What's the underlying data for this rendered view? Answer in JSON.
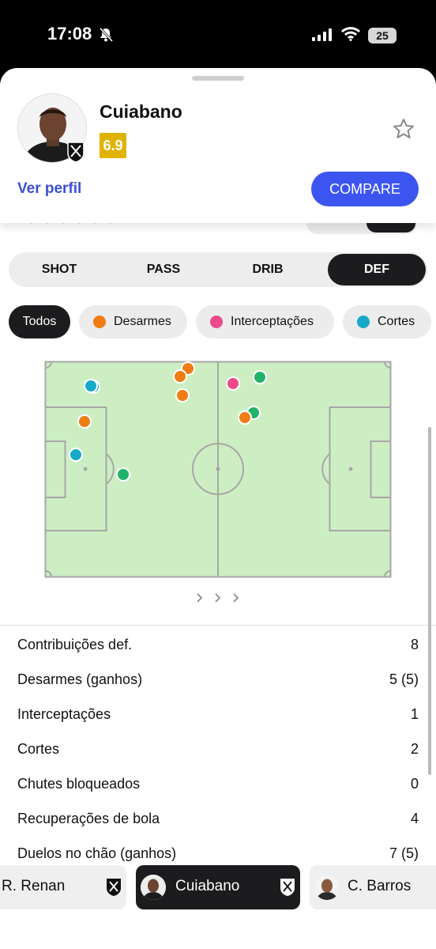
{
  "status_bar": {
    "time": "17:08",
    "battery": "25"
  },
  "player": {
    "name": "Cuiabano",
    "rating": "6.9"
  },
  "header": {
    "view_profile": "Ver perfil",
    "compare": "COMPARE"
  },
  "tabs": [
    {
      "label": "SHOT",
      "active": false
    },
    {
      "label": "PASS",
      "active": false
    },
    {
      "label": "DRIB",
      "active": false
    },
    {
      "label": "DEF",
      "active": true
    }
  ],
  "filters": [
    {
      "label": "Todos",
      "active": true,
      "color": ""
    },
    {
      "label": "Desarmes",
      "active": false,
      "color": "#f07d14"
    },
    {
      "label": "Interceptações",
      "active": false,
      "color": "#ec4a8a"
    },
    {
      "label": "Cortes",
      "active": false,
      "color": "#16aac8"
    }
  ],
  "colors": {
    "tackle": "#f07d14",
    "interception": "#ec4a8a",
    "clearance": "#16aac8",
    "other": "#22b36b",
    "pitch": "#cdeec3",
    "accent": "#3d55f0",
    "rating": "#e0b300"
  },
  "stats": [
    {
      "label": "Contribuições def.",
      "value": "8"
    },
    {
      "label": "Desarmes (ganhos)",
      "value": "5 (5)"
    },
    {
      "label": "Interceptações",
      "value": "1"
    },
    {
      "label": "Cortes",
      "value": "2"
    },
    {
      "label": "Chutes bloqueados",
      "value": "0"
    },
    {
      "label": "Recuperações de bola",
      "value": "4"
    },
    {
      "label": "Duelos no chão (ganhos)",
      "value": "7 (5)"
    }
  ],
  "switcher": [
    {
      "name": "R. Renan",
      "active": false
    },
    {
      "name": "Cuiabano",
      "active": true
    },
    {
      "name": "C. Barros",
      "active": false
    }
  ],
  "icons": [
    "bell-slash-icon",
    "signal-icon",
    "wifi-icon",
    "star-icon",
    "club-badge-icon",
    "chevron-right-icon"
  ]
}
